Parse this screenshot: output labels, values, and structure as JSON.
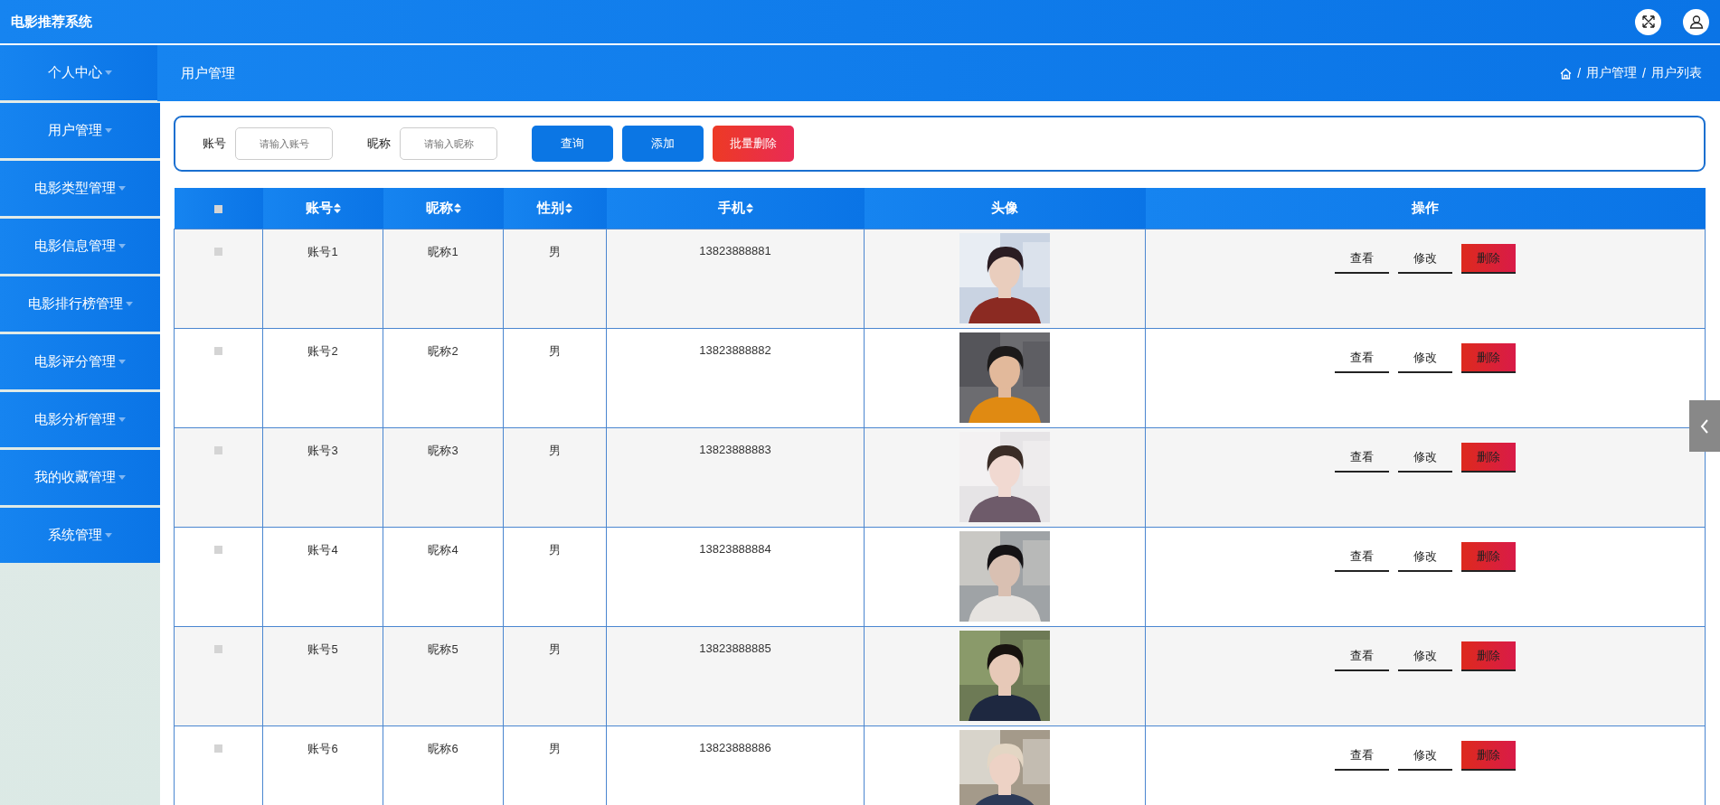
{
  "app": {
    "title": "电影推荐系统"
  },
  "sidebar": {
    "items": [
      {
        "label": "个人中心"
      },
      {
        "label": "用户管理"
      },
      {
        "label": "电影类型管理"
      },
      {
        "label": "电影信息管理"
      },
      {
        "label": "电影排行榜管理"
      },
      {
        "label": "电影评分管理"
      },
      {
        "label": "电影分析管理"
      },
      {
        "label": "我的收藏管理"
      },
      {
        "label": "系统管理"
      }
    ]
  },
  "page_title": "用户管理",
  "breadcrumb": [
    {
      "separator": "/",
      "label": "用户管理"
    },
    {
      "separator": "/",
      "label": "用户列表"
    }
  ],
  "search": {
    "fields": [
      {
        "label": "账号",
        "placeholder": "请输入账号"
      },
      {
        "label": "昵称",
        "placeholder": "请输入昵称"
      }
    ],
    "buttons": [
      {
        "label": "查询",
        "kind": "primary"
      },
      {
        "label": "添加",
        "kind": "primary"
      },
      {
        "label": "批量删除",
        "kind": "danger"
      }
    ]
  },
  "table": {
    "select_all": {
      "checked": false
    },
    "columns": [
      {
        "label": "账号",
        "sortable": true
      },
      {
        "label": "昵称",
        "sortable": true
      },
      {
        "label": "性别",
        "sortable": true
      },
      {
        "label": "手机",
        "sortable": true
      },
      {
        "label": "头像",
        "sortable": false
      },
      {
        "label": "操作",
        "sortable": false
      }
    ],
    "rows": [
      {
        "checked": false,
        "cells": [
          "账号1",
          "昵称1",
          "男",
          "13823888881"
        ],
        "avatar": {
          "kind": "picture"
        },
        "actions": [
          {
            "label": "查看",
            "kind": "plain"
          },
          {
            "label": "修改",
            "kind": "plain"
          },
          {
            "label": "删除",
            "kind": "danger"
          }
        ]
      },
      {
        "checked": false,
        "cells": [
          "账号2",
          "昵称2",
          "男",
          "13823888882"
        ],
        "avatar": {
          "kind": "picture"
        },
        "actions": [
          {
            "label": "查看",
            "kind": "plain"
          },
          {
            "label": "修改",
            "kind": "plain"
          },
          {
            "label": "删除",
            "kind": "danger"
          }
        ]
      },
      {
        "checked": false,
        "cells": [
          "账号3",
          "昵称3",
          "男",
          "13823888883"
        ],
        "avatar": {
          "kind": "picture"
        },
        "actions": [
          {
            "label": "查看",
            "kind": "plain"
          },
          {
            "label": "修改",
            "kind": "plain"
          },
          {
            "label": "删除",
            "kind": "danger"
          }
        ]
      },
      {
        "checked": false,
        "cells": [
          "账号4",
          "昵称4",
          "男",
          "13823888884"
        ],
        "avatar": {
          "kind": "picture"
        },
        "actions": [
          {
            "label": "查看",
            "kind": "plain"
          },
          {
            "label": "修改",
            "kind": "plain"
          },
          {
            "label": "删除",
            "kind": "danger"
          }
        ]
      },
      {
        "checked": false,
        "cells": [
          "账号5",
          "昵称5",
          "男",
          "13823888885"
        ],
        "avatar": {
          "kind": "picture"
        },
        "actions": [
          {
            "label": "查看",
            "kind": "plain"
          },
          {
            "label": "修改",
            "kind": "plain"
          },
          {
            "label": "删除",
            "kind": "danger"
          }
        ]
      },
      {
        "checked": false,
        "cells": [
          "账号6",
          "昵称6",
          "男",
          "13823888886"
        ],
        "avatar": {
          "kind": "picture"
        },
        "actions": [
          {
            "label": "查看",
            "kind": "plain"
          },
          {
            "label": "修改",
            "kind": "plain"
          },
          {
            "label": "删除",
            "kind": "danger"
          }
        ]
      }
    ]
  }
}
